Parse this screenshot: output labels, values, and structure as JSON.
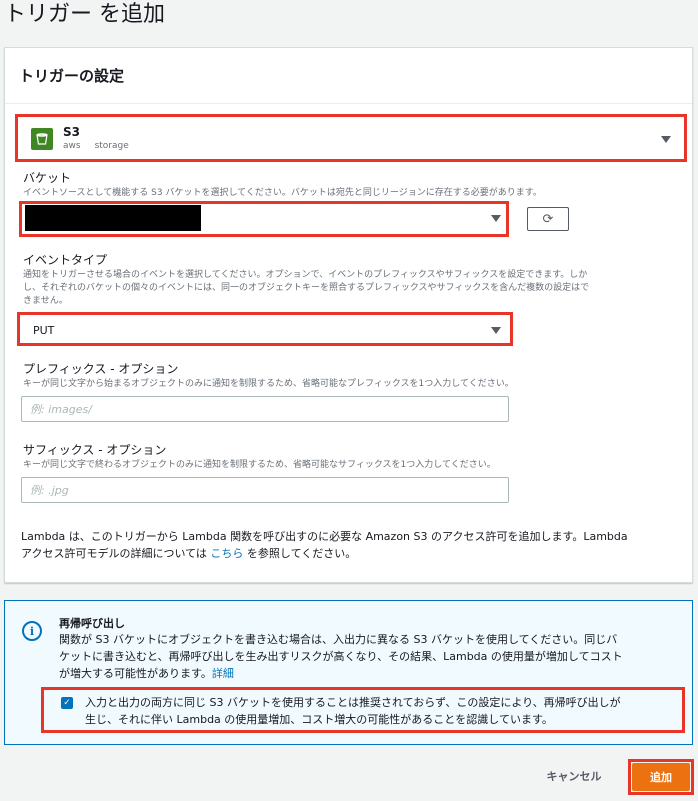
{
  "page": {
    "title": "トリガー を追加"
  },
  "panel": {
    "title": "トリガーの設定"
  },
  "source": {
    "name": "S3",
    "vendor": "aws",
    "category": "storage",
    "icon": "bucket-icon"
  },
  "bucket": {
    "label": "バケット",
    "description": "イベントソースとして機能する S3 バケットを選択してください。バケットは宛先と同じリージョンに存在する必要があります。",
    "refresh_icon": "refresh-icon"
  },
  "event_type": {
    "label": "イベントタイプ",
    "description_1": "通知をトリガーさせる場合のイベントを選択してください。オプションで、イベントのプレフィックスやサフィックスを設定できます。しか",
    "description_2": "し、それぞれのバケットの個々のイベントには、同一のオブジェクトキーを照合するプレフィックスやサフィックスを含んだ複数の設定はで",
    "description_3": "きません。",
    "value": "PUT"
  },
  "prefix": {
    "label": "プレフィックス - オプション",
    "description": "キーが同じ文字から始まるオブジェクトのみに通知を制限するため、省略可能なプレフィックスを1つ入力してください。",
    "placeholder": "例: images/"
  },
  "suffix": {
    "label": "サフィックス - オプション",
    "description": "キーが同じ文字で終わるオブジェクトのみに通知を制限するため、省略可能なサフィックスを1つ入力してください。",
    "placeholder": "例: .jpg"
  },
  "permission": {
    "line1": "Lambda は、このトリガーから Lambda 関数を呼び出すのに必要な Amazon S3 のアクセス許可を追加します。Lambda",
    "line2_pre": "アクセス許可モデルの詳細については ",
    "link": "こちら",
    "line2_post": " を参照してください。"
  },
  "alert": {
    "title": "再帰呼び出し",
    "line1": "関数が S3 バケットにオブジェクトを書き込む場合は、入出力に異なる S3 バケットを使用してください。同じバ",
    "line2": "ケットに書き込むと、再帰呼び出しを生み出すリスクが高くなり、その結果、Lambda の使用量が増加してコスト",
    "line3_pre": "が増大する可能性があります。",
    "link": "詳細",
    "ack_line1": "入力と出力の両方に同じ S3 バケットを使用することは推奨されておらず、この設定により、再帰呼び出しが",
    "ack_line2": "生じ、それに伴い Lambda の使用量増加、コスト増大の可能性があることを認識しています。",
    "ack_checked": true
  },
  "footer": {
    "cancel_label": "キャンセル",
    "add_label": "追加"
  },
  "colors": {
    "highlight": "#e8352a",
    "primary": "#ec7211",
    "link": "#0073bb"
  }
}
